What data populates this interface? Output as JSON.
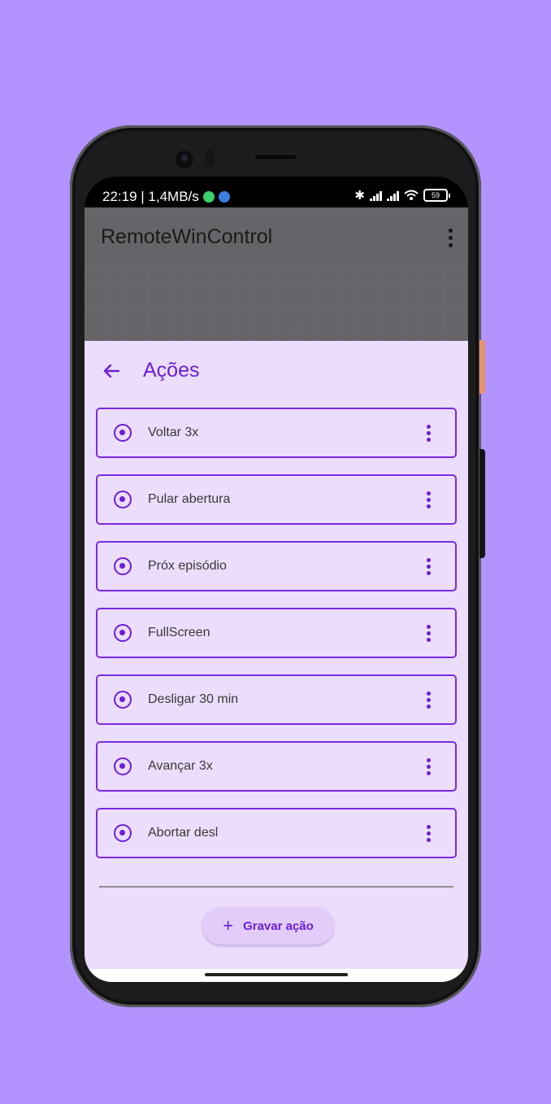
{
  "statusbar": {
    "time": "22:19 | 1,4MB/s",
    "battery": "59"
  },
  "appbar": {
    "title": "RemoteWinControl"
  },
  "sheet": {
    "title": "Ações"
  },
  "actions": [
    {
      "label": "Voltar 3x"
    },
    {
      "label": "Pular abertura"
    },
    {
      "label": "Próx episódio"
    },
    {
      "label": "FullScreen"
    },
    {
      "label": "Desligar 30 min"
    },
    {
      "label": "Avançar 3x"
    },
    {
      "label": "Abortar desl"
    }
  ],
  "fab": {
    "icon": "+",
    "label": "Gravar ação"
  },
  "colors": {
    "background": "#B293FF",
    "accent": "#6C1FD6",
    "sheet": "#EBDDFB"
  }
}
